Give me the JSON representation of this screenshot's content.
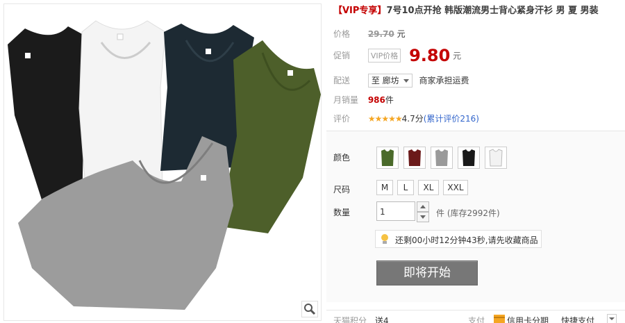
{
  "product": {
    "title_prefix": "【VIP专享】",
    "title": "7号10点开抢 韩版潮流男士背心紧身汗衫 男 夏 男装"
  },
  "price": {
    "label": "价格",
    "original": "29.70",
    "unit": "元"
  },
  "promo": {
    "label": "促销",
    "tag": "VIP价格",
    "price": "9.80",
    "unit": "元"
  },
  "shipping": {
    "label": "配送",
    "destination": "至 廊坊",
    "note": "商家承担运费"
  },
  "sales": {
    "label": "月销量",
    "count": "986",
    "unit": "件"
  },
  "rating": {
    "label": "评价",
    "stars": "★★★★★",
    "score": "4.7分",
    "reviews": "(累计评价216)"
  },
  "options": {
    "color_label": "颜色",
    "colors": [
      {
        "name": "green",
        "hex": "#4a6a2a"
      },
      {
        "name": "burgundy",
        "hex": "#6b1a1a"
      },
      {
        "name": "gray",
        "hex": "#9a9a9a"
      },
      {
        "name": "black",
        "hex": "#1a1a1a"
      },
      {
        "name": "white",
        "hex": "#f2f2f2"
      }
    ],
    "size_label": "尺码",
    "sizes": [
      "M",
      "L",
      "XL",
      "XXL"
    ],
    "qty_label": "数量",
    "qty_value": "1",
    "stock_text": "件  (库存2992件)"
  },
  "countdown": {
    "text": "还剩00小时12分钟43秒,请先收藏商品"
  },
  "cta": {
    "label": "即将开始"
  },
  "footer": {
    "points_label": "天猫积分",
    "points_value": "送4",
    "pay_label": "支付",
    "card_text": "信用卡分期",
    "quick_pay": "快捷支付"
  },
  "icons": {
    "zoom": "magnifier-icon",
    "bulb": "lightbulb-icon",
    "card": "credit-card-icon"
  }
}
